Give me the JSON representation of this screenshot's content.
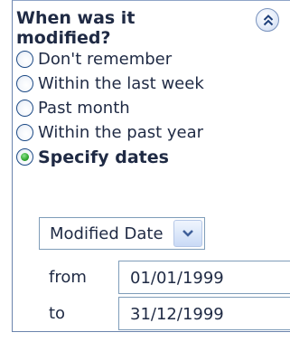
{
  "section": {
    "title": "When was it modified?",
    "collapse_icon": "chevron-double-up-icon"
  },
  "options": [
    {
      "label": "Don't remember",
      "selected": false
    },
    {
      "label": "Within the last week",
      "selected": false
    },
    {
      "label": "Past month",
      "selected": false
    },
    {
      "label": "Within the past year",
      "selected": false
    },
    {
      "label": "Specify dates",
      "selected": true
    }
  ],
  "date_type": {
    "value": "Modified Date",
    "dropdown_icon": "chevron-down-icon"
  },
  "from": {
    "label": "from",
    "value": "01/01/1999"
  },
  "to": {
    "label": "to",
    "value": "31/12/1999"
  },
  "colors": {
    "border": "#7f9db9",
    "radio_selected": "#2ea62e",
    "text": "#1f2a44"
  }
}
